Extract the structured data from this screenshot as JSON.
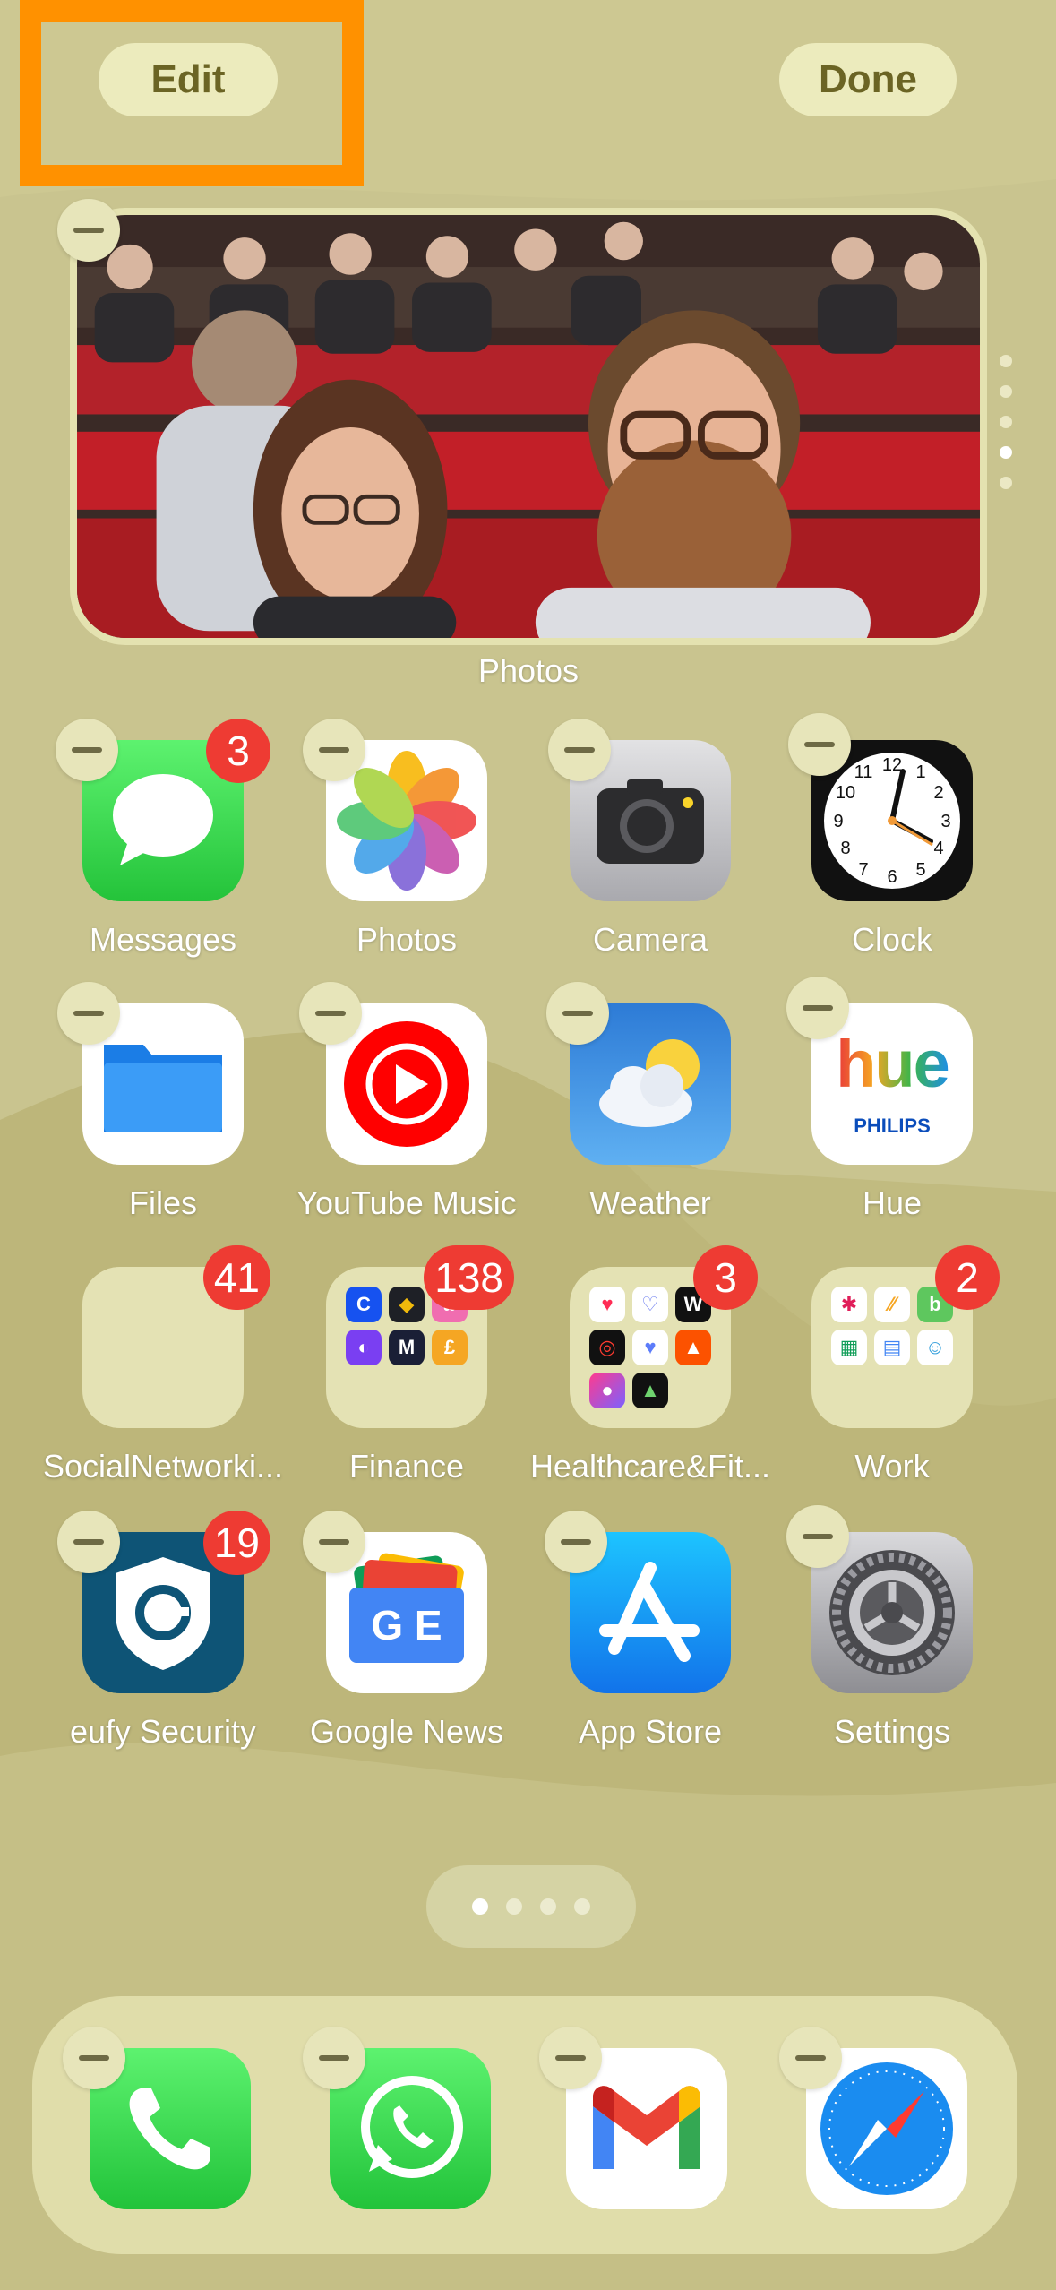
{
  "header": {
    "edit_label": "Edit",
    "done_label": "Done"
  },
  "widget": {
    "label": "Photos"
  },
  "page_indicator": {
    "pages": 4,
    "current": 1
  },
  "apps": [
    {
      "label": "Messages",
      "badge": "3"
    },
    {
      "label": "Photos",
      "badge": ""
    },
    {
      "label": "Camera",
      "badge": ""
    },
    {
      "label": "Clock",
      "badge": ""
    },
    {
      "label": "Files",
      "badge": ""
    },
    {
      "label": "YouTube Music",
      "badge": ""
    },
    {
      "label": "Weather",
      "badge": ""
    },
    {
      "label": "Hue",
      "badge": ""
    },
    {
      "label": "SocialNetworki...",
      "badge": "41"
    },
    {
      "label": "Finance",
      "badge": "138"
    },
    {
      "label": "Healthcare&Fit...",
      "badge": "3"
    },
    {
      "label": "Work",
      "badge": "2"
    },
    {
      "label": "eufy Security",
      "badge": "19"
    },
    {
      "label": "Google News",
      "badge": ""
    },
    {
      "label": "App Store",
      "badge": ""
    },
    {
      "label": "Settings",
      "badge": ""
    }
  ],
  "hue_icon": {
    "wordmark": "hue",
    "brand": "PHILIPS"
  },
  "clock_icon": {
    "numbers": [
      "12",
      "1",
      "2",
      "3",
      "4",
      "5",
      "6",
      "7",
      "8",
      "9",
      "10",
      "11"
    ]
  },
  "finance_folder": {
    "mini_text": [
      "C",
      "",
      "",
      "",
      "M",
      "£"
    ]
  },
  "gnews_icon": {
    "text": "G E"
  },
  "dock": [
    "phone-icon",
    "whatsapp-icon",
    "gmail-icon",
    "safari-icon"
  ],
  "colors": {
    "accent_highlight": "#ff9100",
    "badge": "#ee3b33",
    "button_text": "#6b6424"
  }
}
